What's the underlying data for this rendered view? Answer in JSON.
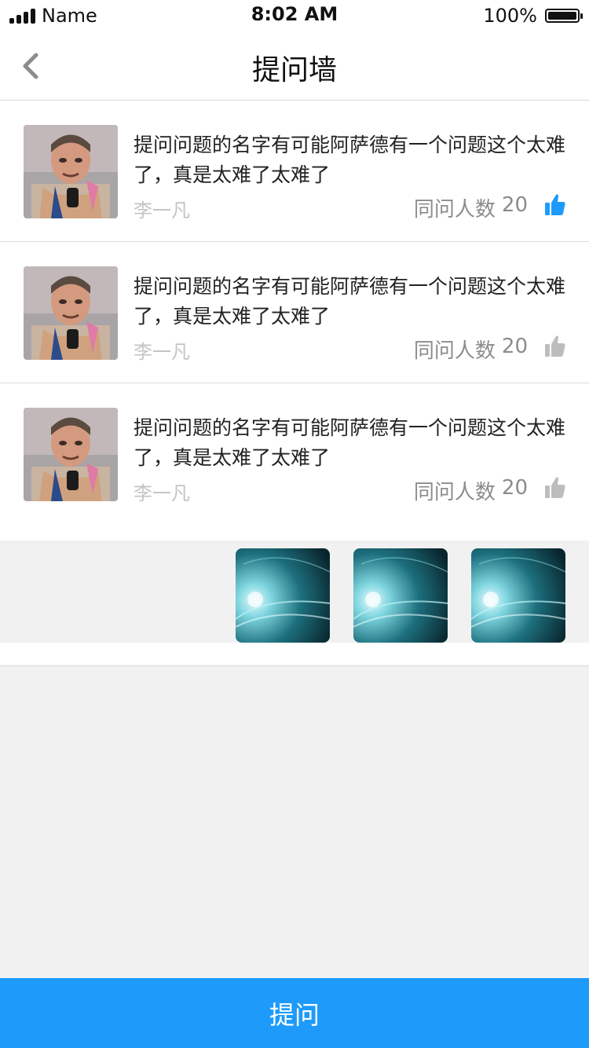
{
  "status": {
    "carrier": "Name",
    "time": "8:02 AM",
    "battery": "100%"
  },
  "nav": {
    "title": "提问墙"
  },
  "colors": {
    "accent": "#1e9bfa",
    "like_active": "#1e9bfa",
    "like_inactive": "#bdbdbd"
  },
  "questions": [
    {
      "text": "提问问题的名字有可能阿萨德有一个问题这个太难了，真是太难了太难了",
      "author": "李一凡",
      "count_label": "同问人数",
      "count": "20",
      "liked": true
    },
    {
      "text": "提问问题的名字有可能阿萨德有一个问题这个太难了，真是太难了太难了",
      "author": "李一凡",
      "count_label": "同问人数",
      "count": "20",
      "liked": false
    },
    {
      "text": "提问问题的名字有可能阿萨德有一个问题这个太难了，真是太难了太难了",
      "author": "李一凡",
      "count_label": "同问人数",
      "count": "20",
      "liked": false
    }
  ],
  "footer": {
    "ask_label": "提问"
  }
}
